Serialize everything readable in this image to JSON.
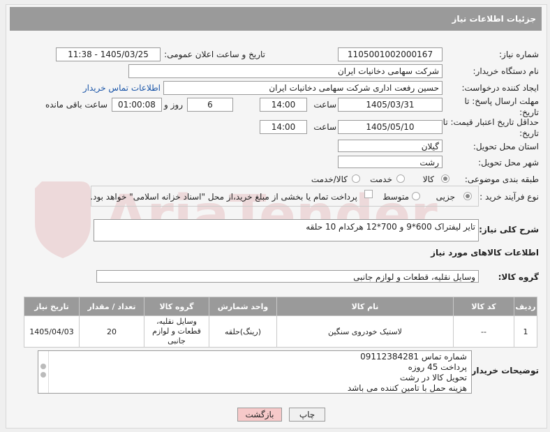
{
  "header": {
    "title": "جزئیات اطلاعات نیاز"
  },
  "fields": {
    "need_number_label": "شماره نیاز:",
    "need_number": "1105001002000167",
    "announce_label": "تاریخ و ساعت اعلان عمومی:",
    "announce_value": "1405/03/25 - 11:38",
    "buyer_org_label": "نام دستگاه خریدار:",
    "buyer_org": "شرکت سهامی دخانیات ایران",
    "creator_label": "ایجاد کننده درخواست:",
    "creator": "حسین رفعت اداری شرکت سهامی دخانیات ایران",
    "contact_link": "اطلاعات تماس خریدار",
    "deadline_label": "مهلت ارسال پاسخ: تا تاریخ:",
    "deadline_date": "1405/03/31",
    "deadline_time_label": "ساعت",
    "deadline_time": "14:00",
    "days_value": "6",
    "days_label": "روز و",
    "remaining_time": "01:00:08",
    "remaining_label": "ساعت باقی مانده",
    "min_validity_label": "حداقل تاریخ اعتبار قیمت: تا تاریخ:",
    "validity_date": "1405/05/10",
    "validity_time_label": "ساعت",
    "validity_time": "14:00",
    "province_label": "استان محل تحویل:",
    "province": "گیلان",
    "city_label": "شهر محل تحویل:",
    "city": "رشت",
    "category_label": "طبقه بندی موضوعی:",
    "category_options": [
      "کالا",
      "خدمت",
      "کالا/خدمت"
    ],
    "process_label": "نوع فرآیند خرید :",
    "process_options": [
      "جزیی",
      "متوسط"
    ],
    "payment_note": "پرداخت تمام یا بخشی از مبلغ خرید،از محل \"اسناد خزانه اسلامی\" خواهد بود.",
    "description_label": "شرح کلی نیاز:",
    "description": "تایر لیفتراک 600*9 و 700*12 هرکدام 10 حلقه",
    "goods_info_title": "اطلاعات کالاهای مورد نیاز",
    "goods_group_label": "گروه کالا:",
    "goods_group": "وسایل نقلیه، قطعات و لوازم جانبی"
  },
  "table": {
    "headers": [
      "ردیف",
      "کد کالا",
      "نام کالا",
      "واحد شمارش",
      "گروه کالا",
      "تعداد / مقدار",
      "تاریخ نیاز"
    ],
    "rows": [
      [
        "1",
        "--",
        "لاستیک خودروی سنگین",
        "(رینگ)حلقه",
        "وسایل نقلیه، قطعات و لوازم جانبی",
        "20",
        "1405/04/03"
      ]
    ]
  },
  "buyer_notes": {
    "label": "توضیحات خریدار:",
    "lines": [
      "شماره تماس 09112384281",
      "پرداخت 45 روزه",
      "تحویل کالا در رشت",
      "هزینه حمل با تامین کننده می باشد"
    ]
  },
  "buttons": {
    "print": "چاپ",
    "back": "بازگشت"
  },
  "watermark": {
    "text": "AriaTender.neT"
  },
  "colors": {
    "header_bg": "#9a9a9a",
    "link": "#1a55a8",
    "back_btn_bg": "#f6c9c9"
  }
}
